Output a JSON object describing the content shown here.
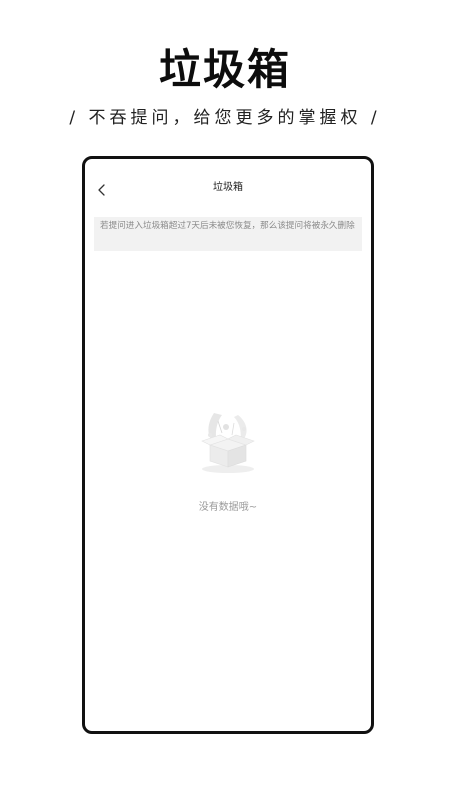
{
  "promo": {
    "title": "垃圾箱",
    "subtitle": "/ 不吞提问，给您更多的掌握权 /"
  },
  "screen": {
    "back_icon": "chevron-left-icon",
    "title": "垃圾箱",
    "notice": "若提问进入垃圾箱超过7天后未被您恢复，那么该提问将被永久删除",
    "empty_illustration": "empty-box-illustration",
    "empty_text": "没有数据哦~"
  },
  "colors": {
    "frame": "#111111",
    "notice_bg": "#f2f2f2",
    "notice_text": "#8a8a8a",
    "empty_text": "#9b9b9b"
  }
}
